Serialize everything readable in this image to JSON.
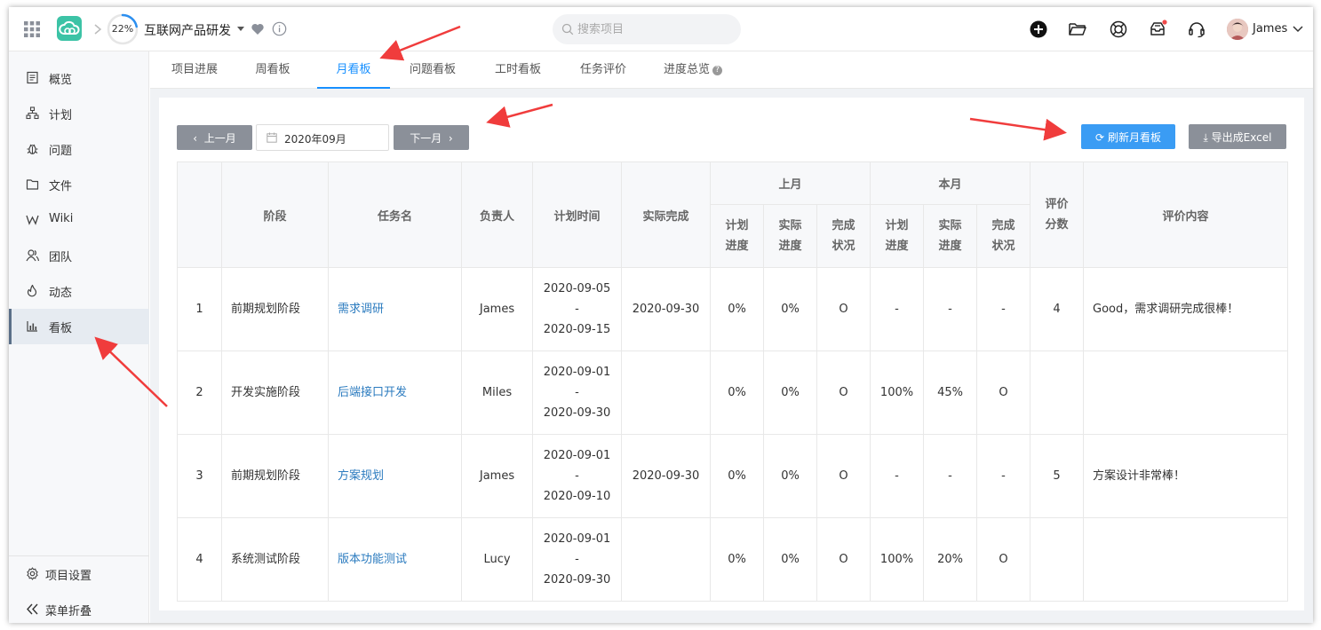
{
  "header": {
    "progress_text": "22%",
    "progress_value": 0.22,
    "project_name": "互联网产品研发",
    "search_placeholder": "搜索项目",
    "user_name": "James",
    "icons": [
      "grid-icon",
      "cloud-logo-icon",
      "chevron-right-icon",
      "caret-down-icon",
      "heart-icon",
      "info-icon",
      "search-icon",
      "plus-circle-icon",
      "folder-icon",
      "lifebuoy-icon",
      "inbox-icon",
      "headset-icon",
      "avatar",
      "chevron-down-icon"
    ]
  },
  "sidebar": {
    "items": [
      {
        "label": "概览",
        "icon": "overview-icon"
      },
      {
        "label": "计划",
        "icon": "plan-icon"
      },
      {
        "label": "问题",
        "icon": "bug-icon"
      },
      {
        "label": "文件",
        "icon": "folder-icon"
      },
      {
        "label": "Wiki",
        "icon": "wiki-icon"
      },
      {
        "label": "团队",
        "icon": "team-icon"
      },
      {
        "label": "动态",
        "icon": "activity-icon"
      },
      {
        "label": "看板",
        "icon": "chart-icon",
        "active": true
      }
    ],
    "settings_label": "项目设置",
    "collapse_label": "菜单折叠"
  },
  "tabs": [
    {
      "label": "项目进展"
    },
    {
      "label": "周看板"
    },
    {
      "label": "月看板",
      "active": true
    },
    {
      "label": "问题看板"
    },
    {
      "label": "工时看板"
    },
    {
      "label": "任务评价"
    },
    {
      "label": "进度总览"
    }
  ],
  "toolbar": {
    "prev_label": "上一月",
    "month_value": "2020年09月",
    "next_label": "下一月",
    "refresh_label": "刷新月看板",
    "export_label": "导出成Excel"
  },
  "table": {
    "headers": {
      "stage": "阶段",
      "task": "任务名",
      "owner": "负责人",
      "plan_time": "计划时间",
      "actual_done": "实际完成",
      "last_month": "上月",
      "this_month": "本月",
      "score": "评价分数",
      "comment": "评价内容",
      "plan_progress": "计划进度",
      "actual_progress": "实际进度",
      "status": "完成状况"
    },
    "rows": [
      {
        "no": "1",
        "stage": "前期规划阶段",
        "task": "需求调研",
        "owner": "James",
        "plan_start": "2020-09-05",
        "sep": "-",
        "plan_end": "2020-09-15",
        "actual": "2020-09-30",
        "lm_plan": "0%",
        "lm_actual": "0%",
        "lm_status": "O",
        "tm_plan": "-",
        "tm_actual": "-",
        "tm_status": "-",
        "score": "4",
        "comment": "Good，需求调研完成很棒！"
      },
      {
        "no": "2",
        "stage": "开发实施阶段",
        "task": "后端接口开发",
        "owner": "Miles",
        "plan_start": "2020-09-01",
        "sep": "-",
        "plan_end": "2020-09-30",
        "actual": "",
        "lm_plan": "0%",
        "lm_actual": "0%",
        "lm_status": "O",
        "tm_plan": "100%",
        "tm_actual": "45%",
        "tm_status": "O",
        "score": "",
        "comment": ""
      },
      {
        "no": "3",
        "stage": "前期规划阶段",
        "task": "方案规划",
        "owner": "James",
        "plan_start": "2020-09-01",
        "sep": "-",
        "plan_end": "2020-09-10",
        "actual": "2020-09-30",
        "lm_plan": "0%",
        "lm_actual": "0%",
        "lm_status": "O",
        "tm_plan": "-",
        "tm_actual": "-",
        "tm_status": "-",
        "score": "5",
        "comment": "方案设计非常棒！"
      },
      {
        "no": "4",
        "stage": "系统测试阶段",
        "task": "版本功能测试",
        "owner": "Lucy",
        "plan_start": "2020-09-01",
        "sep": "-",
        "plan_end": "2020-09-30",
        "actual": "",
        "lm_plan": "0%",
        "lm_actual": "0%",
        "lm_status": "O",
        "tm_plan": "100%",
        "tm_actual": "20%",
        "tm_status": "O",
        "score": "",
        "comment": ""
      }
    ]
  },
  "colors": {
    "accent": "#1890ff",
    "logo": "#3cc3a6",
    "link": "#2b7bbf",
    "annotation_arrow": "#f03c3c",
    "refresh_button": "#3a9cf4",
    "gray_button": "#8b9099"
  }
}
